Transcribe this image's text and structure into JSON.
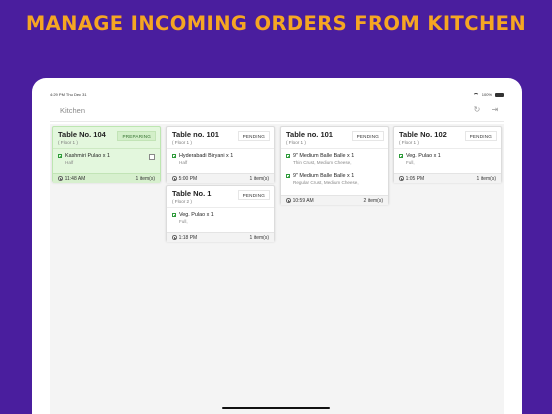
{
  "headline": "MANAGE INCOMING ORDERS FROM KITCHEN",
  "status_bar": {
    "time": "4:29 PM   Thu Dec 31",
    "battery": "100%"
  },
  "app": {
    "title": "Kitchen",
    "refresh_icon": "refresh-icon",
    "logout_icon": "logout-icon"
  },
  "colors": {
    "background": "#4a1e9e",
    "headline": "#f5a623",
    "preparing": "#e3f7dd",
    "veg": "#2e9b3a"
  },
  "orders": [
    {
      "table": "Table No. 104",
      "floor": "( Floor 1 )",
      "status": "PREPARING",
      "items": [
        {
          "name": "Kashmiri Pulao x 1",
          "note": "Half"
        }
      ],
      "time": "11:48 AM",
      "count": "1 item(s)"
    },
    {
      "table": "Table no. 101",
      "floor": "( Floor 1 )",
      "status": "PENDING",
      "items": [
        {
          "name": "Hyderabadi Biryani x 1",
          "note": "Half"
        }
      ],
      "time": "5:00 PM",
      "count": "1 item(s)"
    },
    {
      "table": "Table No. 1",
      "floor": "( Floor 2 )",
      "status": "PENDING",
      "items": [
        {
          "name": "Veg. Pulao x 1",
          "note": "Full,"
        }
      ],
      "time": "1:18 PM",
      "count": "1 item(s)"
    },
    {
      "table": "Table no. 101",
      "floor": "( Floor 1 )",
      "status": "PENDING",
      "items": [
        {
          "name": "9\" Medium Balle Balle x 1",
          "note": "Thin Crust, Medium Cheese,"
        },
        {
          "name": "9\" Medium Balle Balle x 1",
          "note": "Regular Crust, Medium Cheese,"
        }
      ],
      "time": "10:59 AM",
      "count": "2 item(s)"
    },
    {
      "table": "Table No. 102",
      "floor": "( Floor 1 )",
      "status": "PENDING",
      "items": [
        {
          "name": "Veg. Pulao x 1",
          "note": "Full,"
        }
      ],
      "time": "1:05 PM",
      "count": "1 item(s)"
    }
  ]
}
